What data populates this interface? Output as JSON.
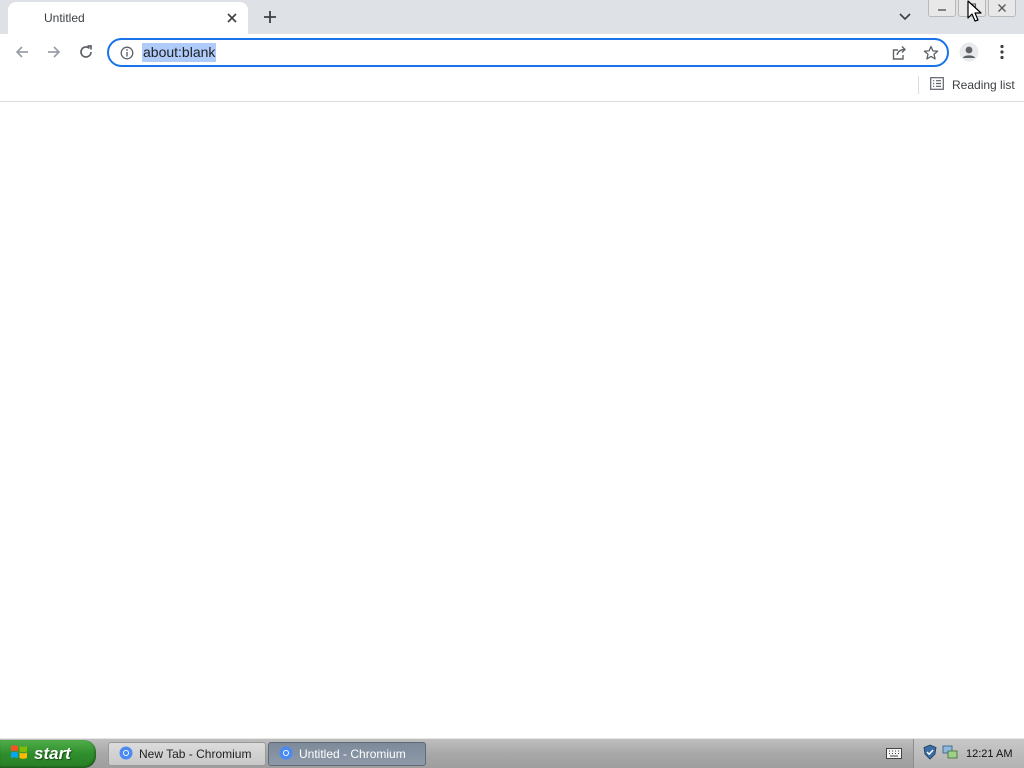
{
  "browser": {
    "tab": {
      "title": "Untitled"
    },
    "omnibox": {
      "url": "about:blank"
    },
    "bookmarks_bar": {
      "reading_list_label": "Reading list"
    }
  },
  "taskbar": {
    "start_label": "start",
    "windows": [
      {
        "label": "New Tab - Chromium",
        "active": false
      },
      {
        "label": "Untitled - Chromium",
        "active": true
      }
    ],
    "clock": "12:21 AM"
  },
  "icons": {
    "tab_close": "close-icon",
    "new_tab": "plus-icon",
    "tab_search": "chevron-down-icon",
    "back": "arrow-left-icon",
    "forward": "arrow-right-icon",
    "reload": "reload-icon",
    "site_info": "info-icon",
    "share": "share-icon",
    "bookmark": "star-icon",
    "profile": "avatar-icon",
    "menu": "kebab-menu-icon",
    "reading_list": "reading-list-icon"
  },
  "colors": {
    "tabstrip_bg": "#dee1e6",
    "omnibox_focus": "#1a73e8",
    "url_selection": "#aecbfa",
    "start_green": "#2f8e2c"
  }
}
